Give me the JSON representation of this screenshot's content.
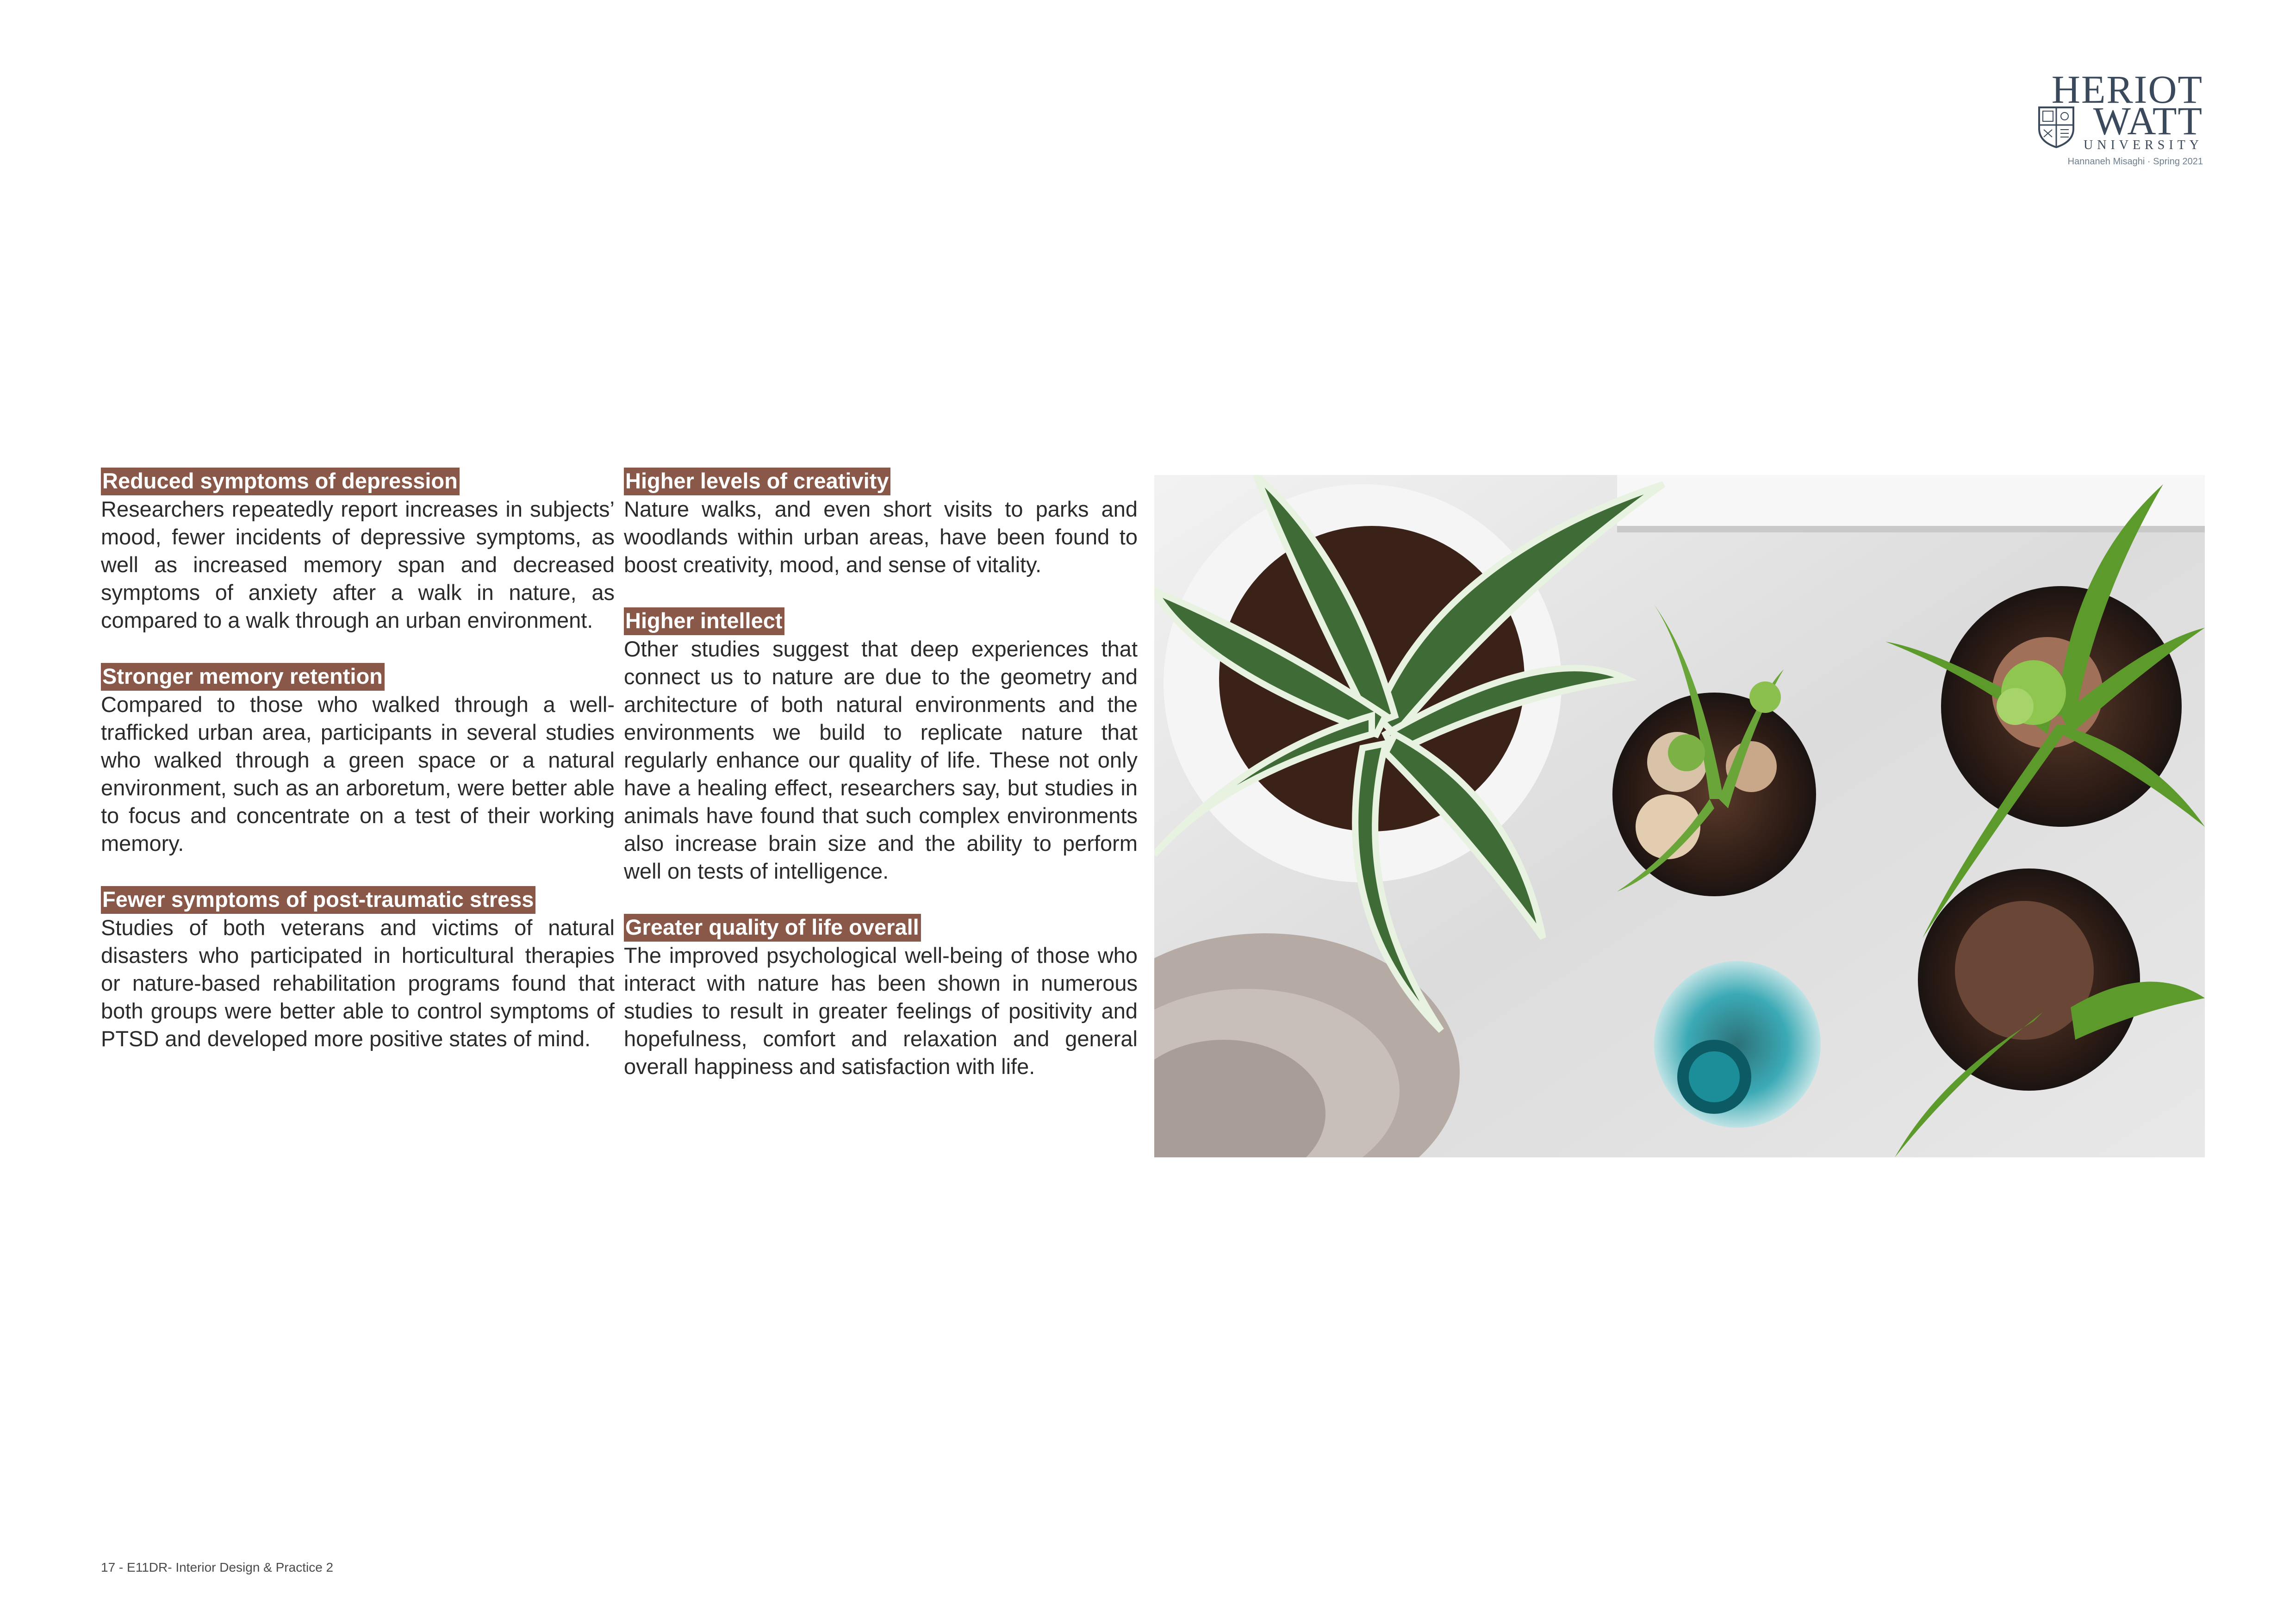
{
  "logo": {
    "line1": "HERIOT",
    "line2": "WATT",
    "line3": "UNIVERSITY",
    "author": "Hannaneh Misaghi · Spring 2021"
  },
  "sections": [
    {
      "heading": "Reduced symptoms of depression",
      "body": "Researchers repeatedly report increases in subjects’ mood, fewer incidents of depressive symptoms, as well as increased memory span and decreased symptoms of anxiety after a walk in nature, as compared to a walk through an urban environment."
    },
    {
      "heading": "Stronger memory retention",
      "body": "Compared to those who walked through a well-trafficked urban area, participants in several studies who walked through a green space or a natural environment, such as an arboretum, were better able to focus and concentrate on a test of their working memory."
    },
    {
      "heading": "Fewer symptoms of post-traumatic stress",
      "body": "Studies of both veterans and victims of natural disasters who participated in horticultural therapies or nature-based rehabilitation programs found that both groups were better able to control symptoms of PTSD and developed more positive states of mind."
    },
    {
      "heading": "Higher levels of creativity",
      "body": "Nature walks, and even short visits to parks and woodlands within urban areas, have been found to boost creativity, mood, and sense of vitality."
    },
    {
      "heading": "Higher intellect",
      "body": "Other studies suggest that deep experiences that connect us to nature are due to the geometry and architecture of both natural environments and the environments we build to replicate nature that regularly enhance our quality of life. These not only have a healing effect, researchers say, but studies in animals have found that such complex environments also increase brain size and the ability to perform well on tests of intelligence."
    },
    {
      "heading": "Greater quality of life overall",
      "body": "The improved psychological well-being of those who interact with nature has been shown in numerous studies to result in greater feelings of positivity and hopefulness, comfort and relaxation and general overall happiness and satisfaction with life."
    }
  ],
  "footer": "17  - E11DR- Interior Design & Practice 2"
}
